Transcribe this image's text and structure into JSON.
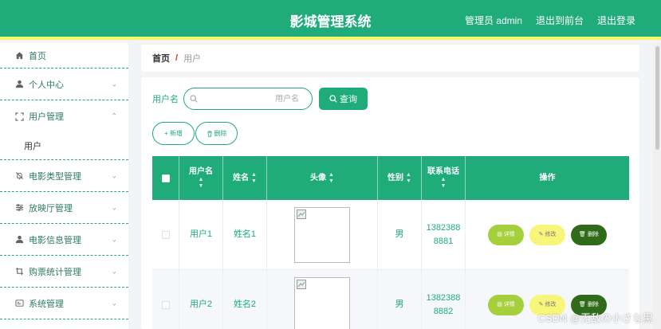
{
  "header": {
    "title": "影城管理系统",
    "admin_label": "管理员 admin",
    "front_label": "退出到前台",
    "logout_label": "退出登录"
  },
  "sidebar": {
    "items": [
      {
        "label": "首页",
        "icon": "home-icon"
      },
      {
        "label": "个人中心",
        "icon": "user-icon"
      },
      {
        "label": "用户管理",
        "icon": "fullscreen-icon",
        "open": true,
        "sub": [
          "用户"
        ]
      },
      {
        "label": "电影类型管理",
        "icon": "bell-off-icon"
      },
      {
        "label": "放映厅管理",
        "icon": "sliders-icon"
      },
      {
        "label": "电影信息管理",
        "icon": "user-icon"
      },
      {
        "label": "购票统计管理",
        "icon": "crop-icon"
      },
      {
        "label": "系统管理",
        "icon": "message-box-icon"
      }
    ]
  },
  "breadcrumb": {
    "home": "首页",
    "sep": "/",
    "current": "用户"
  },
  "search": {
    "label": "用户名",
    "placeholder": "用户名",
    "value": "",
    "button": "查询"
  },
  "actions": {
    "add": "新增",
    "delete": "删除"
  },
  "table": {
    "headers": [
      "用户名",
      "姓名",
      "头像",
      "性别",
      "联系电话",
      "操作"
    ],
    "rows": [
      {
        "username": "用户1",
        "name": "姓名1",
        "gender": "男",
        "phone_line1": "1382388",
        "phone_line2": "8881"
      },
      {
        "username": "用户2",
        "name": "姓名2",
        "gender": "男",
        "phone_line1": "1382388",
        "phone_line2": "8882"
      }
    ],
    "ops": {
      "detail": "详情",
      "edit": "修改",
      "delete": "删除"
    }
  },
  "watermark": "CSDN @无敌の小さな黑",
  "colors": {
    "primary": "#1fac7a",
    "header_border": "#f7f36a",
    "detail": "#a6cf3c",
    "edit": "#f8f67a",
    "delete": "#2f6b1a"
  }
}
